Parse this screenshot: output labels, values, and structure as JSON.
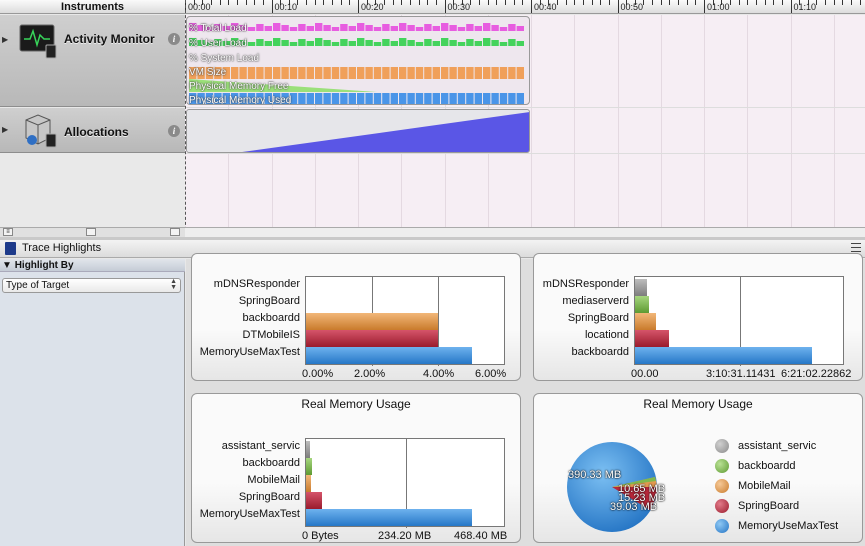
{
  "header": {
    "instruments_label": "Instruments"
  },
  "ruler": {
    "labels": [
      "00:00",
      "00:10",
      "00:20",
      "00:30",
      "00:40",
      "00:50",
      "01:00",
      "01:10"
    ]
  },
  "instruments": [
    {
      "name": "Activity Monitor",
      "info": "i"
    },
    {
      "name": "Allocations",
      "info": "i"
    }
  ],
  "activity_track": {
    "labels": [
      "% Total Load",
      "% User Load",
      "% System Load",
      "VM Size",
      "Physical Memory Free",
      "Physical Memory Used"
    ]
  },
  "trace": {
    "title": "Trace Highlights",
    "highlight_by": "Highlight By",
    "target_select": "Type of Target"
  },
  "colors": {
    "blue": "#3b8fd9",
    "orange": "#e39a50",
    "red": "#b8283a",
    "green": "#7fb84e",
    "gray": "#9a9a9a",
    "track_pink": "#e75de0",
    "track_green": "#44d35c",
    "track_orange": "#f0a05a",
    "track_blue": "#4a95e8",
    "alloc": "#5a56e6"
  },
  "cards": {
    "top_left": {
      "categories": [
        "mDNSResponder",
        "SpringBoard",
        "backboardd",
        "DTMobileIS",
        "MemoryUseMaxTest"
      ],
      "xticks": [
        "0.00%",
        "2.00%",
        "4.00%",
        "6.00%"
      ]
    },
    "top_right": {
      "categories": [
        "mDNSResponder",
        "mediaserverd",
        "SpringBoard",
        "locationd",
        "backboardd"
      ],
      "xticks": [
        "00.00",
        "3:10:31.11431",
        "6:21:02.22862"
      ]
    },
    "bottom_left": {
      "title": "Real Memory Usage",
      "categories": [
        "assistant_servic",
        "backboardd",
        "MobileMail",
        "SpringBoard",
        "MemoryUseMaxTest"
      ],
      "xticks": [
        "0 Bytes",
        "234.20 MB",
        "468.40 MB"
      ]
    },
    "bottom_right": {
      "title": "Real Memory Usage",
      "legend": [
        "assistant_servic",
        "backboardd",
        "MobileMail",
        "SpringBoard",
        "MemoryUseMaxTest"
      ],
      "slice_labels": [
        "390.33 MB",
        "10.65 MB",
        "15.23 MB",
        "39.03 MB"
      ]
    }
  }
}
